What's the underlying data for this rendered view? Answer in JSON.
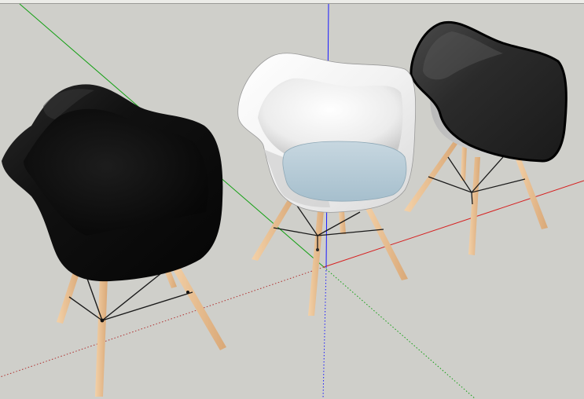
{
  "viewport": {
    "background": "#cfcfca",
    "axes": {
      "red_axis_color": "#d62020",
      "green_axis_color": "#14a014",
      "blue_axis_color": "#1a1aff"
    }
  },
  "models": [
    {
      "name": "left-black-armchair",
      "shell_color": "#0e0e0e",
      "leg_color": "#e7bf94"
    },
    {
      "name": "center-white-armchair",
      "shell_color": "#f6f6f6",
      "seat_pad_color": "#b7ccd8",
      "leg_color": "#e7bf94"
    },
    {
      "name": "right-dark-armchair",
      "shell_color": "#202020",
      "leg_color": "#e7bf94"
    }
  ]
}
